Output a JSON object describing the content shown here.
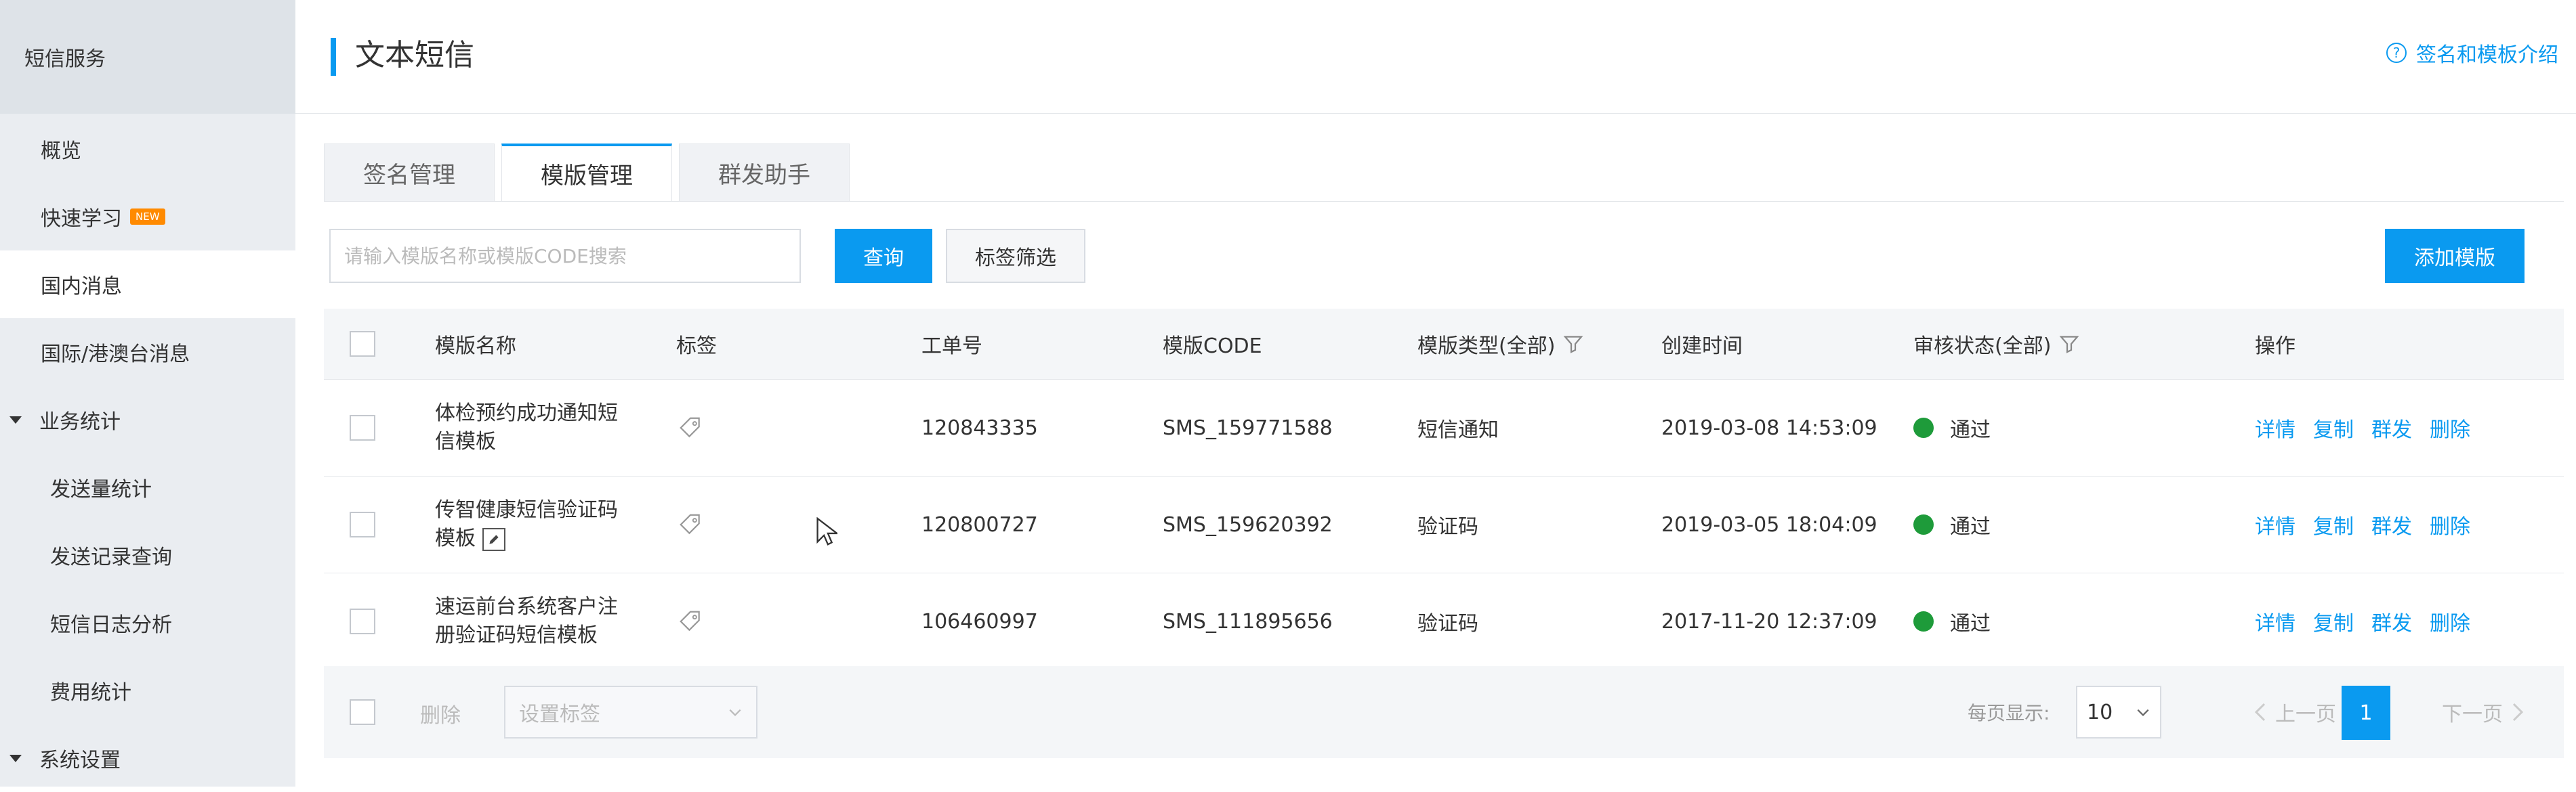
{
  "sidebar": {
    "header": "短信服务",
    "items": [
      {
        "label": "概览"
      },
      {
        "label": "快速学习",
        "badge": "NEW"
      },
      {
        "label": "国内消息"
      },
      {
        "label": "国际/港澳台消息"
      },
      {
        "label": "业务统计"
      },
      {
        "label": "发送量统计"
      },
      {
        "label": "发送记录查询"
      },
      {
        "label": "短信日志分析"
      },
      {
        "label": "费用统计"
      },
      {
        "label": "系统设置"
      }
    ]
  },
  "header": {
    "title": "文本短信",
    "help_link": "签名和模板介绍"
  },
  "tabs": [
    "签名管理",
    "模版管理",
    "群发助手"
  ],
  "toolbar": {
    "search_placeholder": "请输入模版名称或模版CODE搜索",
    "query_button": "查询",
    "tag_filter_button": "标签筛选",
    "add_button": "添加模版"
  },
  "table": {
    "columns": [
      "模版名称",
      "标签",
      "工单号",
      "模版CODE",
      "模版类型(全部)",
      "创建时间",
      "审核状态(全部)",
      "操作"
    ],
    "rows": [
      {
        "name_line1": "体检预约成功通知短",
        "name_line2": "信模板",
        "order_no": "120843335",
        "code": "SMS_159771588",
        "type": "短信通知",
        "created": "2019-03-08 14:53:09",
        "status": "通过"
      },
      {
        "name_line1": "传智健康短信验证码",
        "name_line2": "模板",
        "order_no": "120800727",
        "code": "SMS_159620392",
        "type": "验证码",
        "created": "2019-03-05 18:04:09",
        "status": "通过"
      },
      {
        "name_line1": "速运前台系统客户注",
        "name_line2": "册验证码短信模板",
        "order_no": "106460997",
        "code": "SMS_111895656",
        "type": "验证码",
        "created": "2017-11-20 12:37:09",
        "status": "通过"
      }
    ],
    "actions": [
      "详情",
      "复制",
      "群发",
      "删除"
    ]
  },
  "footer": {
    "delete_label": "删除",
    "set_tag_placeholder": "设置标签",
    "page_size_label": "每页显示:",
    "page_size": "10",
    "prev_label": "上一页",
    "current_page": "1",
    "next_label": "下一页"
  },
  "colors": {
    "accent": "#0a9af0",
    "success": "#1e9b3a",
    "badge": "#ff8a00"
  }
}
